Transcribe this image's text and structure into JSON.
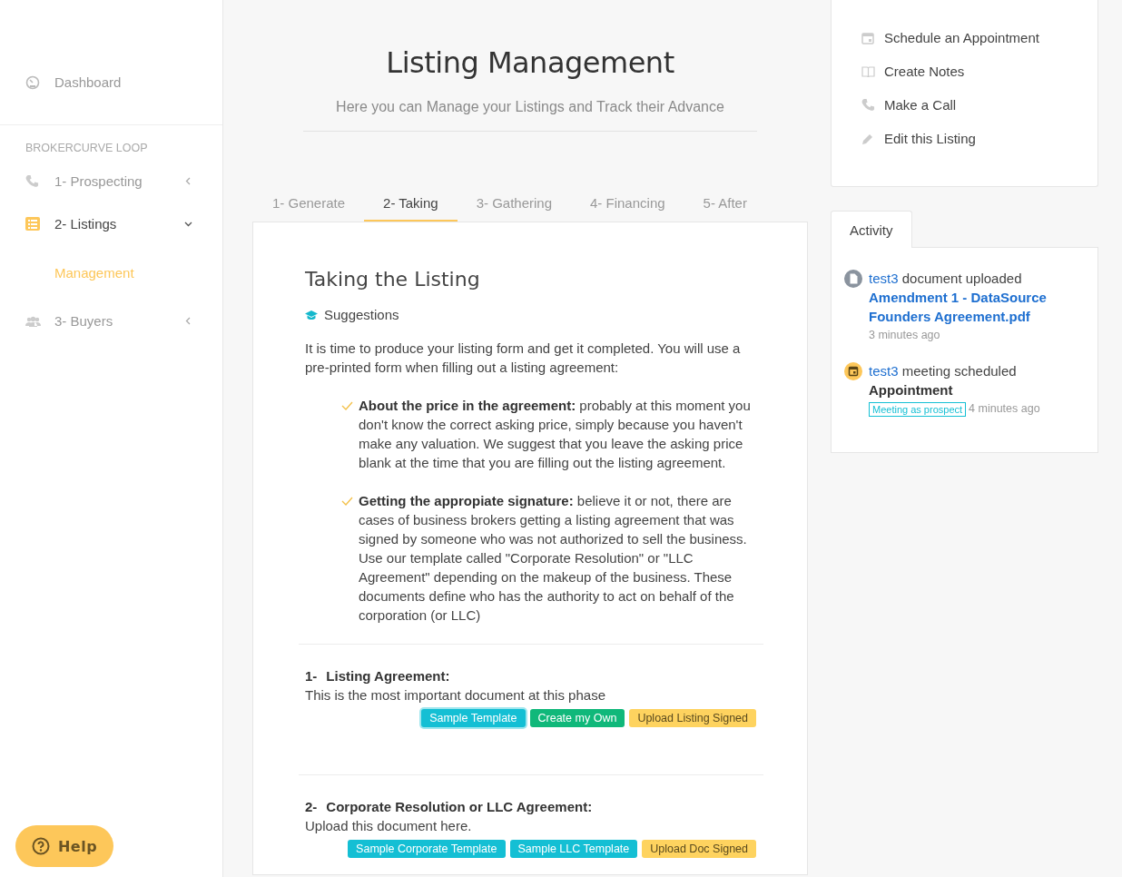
{
  "sidebar": {
    "top_item": {
      "label": "Dashboard"
    },
    "section_title": "BROKERCURVE LOOP",
    "items": [
      {
        "kind": "prospecting",
        "label": "1- Prospecting",
        "expanded": false
      },
      {
        "kind": "listings",
        "label": "2- Listings",
        "expanded": true,
        "children": [
          {
            "label": "Management",
            "selected": true
          }
        ]
      },
      {
        "kind": "buyers",
        "label": "3- Buyers",
        "expanded": false
      }
    ]
  },
  "help_button": {
    "label": "Help"
  },
  "header": {
    "title": "Listing Management",
    "subtitle": "Here you can Manage your Listings and Track their Advance"
  },
  "tabs": [
    {
      "label": "1- Generate",
      "selected": false
    },
    {
      "label": "2- Taking",
      "selected": true
    },
    {
      "label": "3- Gathering",
      "selected": false
    },
    {
      "label": "4- Financing",
      "selected": false
    },
    {
      "label": "5- After",
      "selected": false
    }
  ],
  "content": {
    "title": "Taking the Listing",
    "suggestions_label": "Suggestions",
    "intro": "It is time to produce your listing form and get it completed. You will use a pre-printed form when filling out a listing agreement:",
    "tips": [
      "**About the price in the agreement:** probably at this moment you don't know the correct asking price, simply because you haven't make any valuation. We suggest that you leave the asking price blank at the time that you are filling out the listing agreement.",
      "**Getting the appropiate signature:** believe it or not, there are cases of business brokers getting a listing agreement that was signed by someone who was not authorized to sell the business. Use our template called \"Corporate Resolution\" or \"LLC Agreement\" depending on the makeup of the business. These documents define who has the authority to act on behalf of the corporation (or LLC)"
    ],
    "documents": [
      {
        "number": "1-",
        "title": "Listing Agreement:",
        "description": "This is the most important document at this phase",
        "buttons": [
          {
            "label": "Sample Template",
            "kind": "info",
            "focused": true
          },
          {
            "label": "Create my Own",
            "kind": "success",
            "focused": false
          },
          {
            "label": "Upload Listing Signed",
            "kind": "warning",
            "focused": false
          }
        ]
      },
      {
        "number": "2-",
        "title": "Corporate Resolution or LLC Agreement:",
        "description": "Upload this document here.",
        "buttons": [
          {
            "label": "Sample Corporate Template",
            "kind": "info",
            "focused": false
          },
          {
            "label": "Sample LLC Template",
            "kind": "info",
            "focused": false
          },
          {
            "label": "Upload Doc Signed",
            "kind": "warning",
            "focused": false
          }
        ]
      }
    ]
  },
  "actions": [
    {
      "kind": "schedule",
      "label": "Schedule an Appointment"
    },
    {
      "kind": "notes",
      "label": "Create Notes"
    },
    {
      "kind": "call",
      "label": "Make a Call"
    },
    {
      "kind": "edit",
      "label": "Edit this Listing"
    }
  ],
  "activity": {
    "tab": "Activity",
    "entries": [
      {
        "kind": "document",
        "user": "test3",
        "action": "document uploaded",
        "subject": "Amendment 1 - DataSource Founders Agreement.pdf",
        "time": "3 minutes ago"
      },
      {
        "kind": "meeting",
        "user": "test3",
        "action": "meeting scheduled",
        "subject": "Appointment",
        "tag": "Meeting as prospect",
        "time": "4 minutes ago"
      }
    ]
  }
}
